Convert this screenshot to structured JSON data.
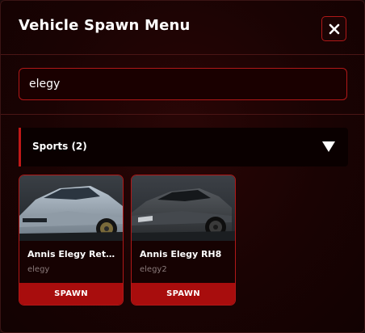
{
  "header": {
    "title": "Vehicle Spawn Menu",
    "close_icon": "close-icon"
  },
  "search": {
    "value": "elegy",
    "placeholder": ""
  },
  "category": {
    "label": "Sports (2)",
    "expanded": true,
    "toggle_icon": "triangle-down-icon"
  },
  "vehicles": [
    {
      "name": "Annis Elegy Retro Custom",
      "model": "elegy",
      "spawn_label": "SPAWN",
      "image": "vehicle-image-silver-coupe"
    },
    {
      "name": "Annis Elegy RH8",
      "model": "elegy2",
      "spawn_label": "SPAWN",
      "image": "vehicle-image-dark-coupe"
    }
  ],
  "colors": {
    "accent": "#b01818",
    "spawn_button": "#a80d0d",
    "panel_background": "#1a0303"
  }
}
